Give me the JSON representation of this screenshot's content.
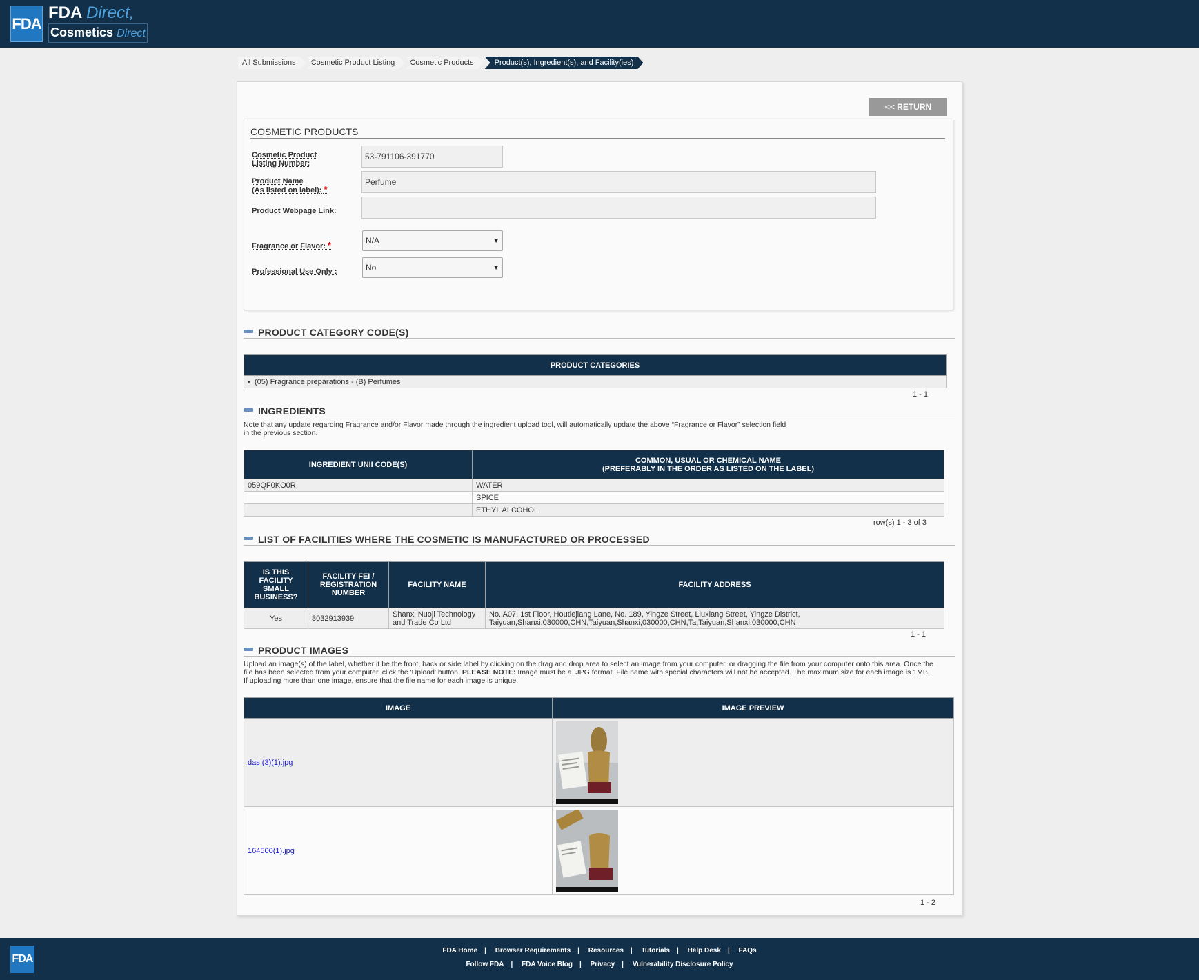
{
  "header": {
    "logo_badge": "FDA",
    "brand_line1": "FDA",
    "brand_line1_accent": "Direct",
    "brand_line2": "Cosmetics",
    "brand_line2_accent": "Direct"
  },
  "breadcrumb": [
    "All Submissions",
    "Cosmetic Product Listing",
    "Cosmetic Products",
    "Product(s), Ingredient(s), and Facility(ies)"
  ],
  "return_label": "<< RETURN",
  "cosmetic_products": {
    "title": "COSMETIC PRODUCTS",
    "listing_label_1": "Cosmetic Product",
    "listing_label_2": "Listing Number:",
    "listing_number": "53-791106-391770",
    "name_label_1": "Product Name",
    "name_label_2": "(As listed on label):",
    "product_name": "Perfume",
    "webpage_label": "Product Webpage Link:",
    "webpage_value": "",
    "fragrance_label": "Fragrance or Flavor:",
    "fragrance_value": "N/A",
    "pro_use_label": "Professional Use Only :",
    "pro_use_value": "No",
    "required_mark": "*"
  },
  "category_section": {
    "title": "PRODUCT CATEGORY CODE(S)",
    "header": "PRODUCT CATEGORIES",
    "items": [
      "(05) Fragrance preparations - (B) Perfumes"
    ],
    "pager": "1 - 1"
  },
  "ingredients_section": {
    "title": "INGREDIENTS",
    "note_line1": "Note that any update regarding Fragrance and/or Flavor made through the ingredient upload tool, will automatically update the above “Fragrance or Flavor” selection field",
    "note_line2": "in the previous section.",
    "col1": "INGREDIENT UNII CODE(S)",
    "col2_line1": "COMMON, USUAL OR CHEMICAL NAME",
    "col2_line2": "(PREFERABLY IN THE ORDER AS LISTED ON THE LABEL)",
    "rows": [
      {
        "code": "059QF0KO0R",
        "name": "WATER"
      },
      {
        "code": "",
        "name": "SPICE"
      },
      {
        "code": "",
        "name": "ETHYL ALCOHOL"
      }
    ],
    "pager": "row(s) 1 - 3 of 3"
  },
  "facilities_section": {
    "title": "LIST OF FACILITIES WHERE THE COSMETIC IS MANUFACTURED OR PROCESSED",
    "col1_lines": [
      "IS THIS",
      "FACILITY",
      "SMALL",
      "BUSINESS?"
    ],
    "col2_lines": [
      "FACILITY FEI /",
      "REGISTRATION",
      "NUMBER"
    ],
    "col3": "FACILITY NAME",
    "col4": "FACILITY ADDRESS",
    "rows": [
      {
        "small_business": "Yes",
        "fei": "3032913939",
        "name_line1": "Shanxi Nuoji Technology",
        "name_line2": "and Trade Co Ltd",
        "address_line1": "No. A07, 1st Floor, Houtiejiang Lane, No. 189, Yingze Street, Liuxiang Street, Yingze District,",
        "address_line2": "Taiyuan,Shanxi,030000,CHN,Taiyuan,Shanxi,030000,CHN,Ta,Taiyuan,Shanxi,030000,CHN"
      }
    ],
    "pager": "1 - 1"
  },
  "images_section": {
    "title": "PRODUCT IMAGES",
    "note_line1": "Upload an image(s) of the label, whether it be the front, back or side label by clicking on the drag and drop area to select an image from your computer, or dragging the file from your computer onto this area. Once the",
    "note_line2a": "file has been selected from your computer, click the 'Upload' button. ",
    "note_line2b": "PLEASE NOTE:",
    "note_line2c": " Image must be a .JPG format. File name with special characters will not be accepted. The maximum size for each image is 1MB.",
    "note_line3": "If uploading more than one image, ensure that the file name for each image is unique.",
    "col1": "IMAGE",
    "col2": "IMAGE PREVIEW",
    "rows": [
      {
        "file": "das (3)(1).jpg"
      },
      {
        "file": "164500(1).jpg"
      }
    ],
    "pager": "1 - 2"
  },
  "footer": {
    "logo": "FDA",
    "links_row1": [
      "FDA Home",
      "Browser Requirements",
      "Resources",
      "Tutorials",
      "Help Desk",
      "FAQs"
    ],
    "links_row2": [
      "Follow FDA",
      "FDA Voice Blog",
      "Privacy",
      "Vulnerability Disclosure Policy"
    ],
    "separator": "|"
  }
}
